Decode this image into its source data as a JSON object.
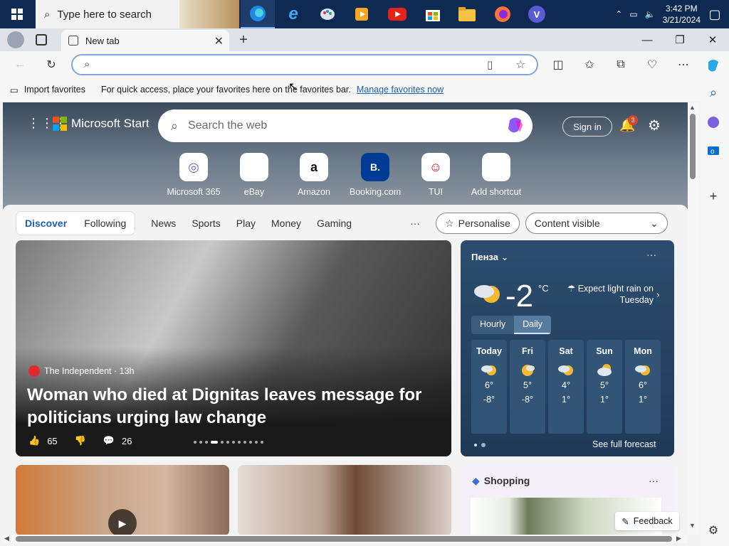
{
  "taskbar": {
    "search_placeholder": "Type here to search",
    "clock_time": "3:42 PM",
    "clock_date": "3/21/2024",
    "apps": [
      "edge",
      "ie",
      "paint",
      "media",
      "youtube",
      "store",
      "explorer",
      "firefox",
      "vpn"
    ],
    "vpn_letter": "V"
  },
  "browser": {
    "tab_title": "New tab",
    "address_value": "",
    "favorites": {
      "import_label": "Import favorites",
      "hint": "For quick access, place your favorites here on the favorites bar.",
      "manage_link": "Manage favorites now"
    }
  },
  "msn": {
    "brand": "Microsoft Start",
    "search_placeholder": "Search the web",
    "sign_in": "Sign in",
    "notification_count": "3",
    "shortcuts": [
      {
        "label": "Microsoft 365",
        "glyph": "◎"
      },
      {
        "label": "eBay",
        "glyph": "🛍"
      },
      {
        "label": "Amazon",
        "glyph": "a"
      },
      {
        "label": "Booking.com",
        "glyph": "B."
      },
      {
        "label": "TUI",
        "glyph": "☺"
      },
      {
        "label": "Add shortcut",
        "glyph": "+"
      }
    ],
    "feed_tabs": [
      "Discover",
      "Following",
      "News",
      "Sports",
      "Play",
      "Money",
      "Gaming"
    ],
    "more": "···",
    "personalise": "Personalise",
    "content_visible": "Content visible"
  },
  "news": {
    "source": "The Independent · 13h",
    "title": "Woman who died at Dignitas leaves message for politicians urging law change",
    "likes": "65",
    "comments": "26"
  },
  "weather": {
    "city": "Пенза",
    "temp": "-2",
    "unit": "°C",
    "expect": "Expect light rain on Tuesday",
    "modes": [
      "Hourly",
      "Daily"
    ],
    "days": [
      {
        "day": "Today",
        "hi": "6°",
        "lo": "-8°"
      },
      {
        "day": "Fri",
        "hi": "5°",
        "lo": "-8°"
      },
      {
        "day": "Sat",
        "hi": "4°",
        "lo": "1°"
      },
      {
        "day": "Sun",
        "hi": "5°",
        "lo": "1°"
      },
      {
        "day": "Mon",
        "hi": "6°",
        "lo": "1°"
      }
    ],
    "full_forecast": "See full forecast"
  },
  "shopping": {
    "title": "Shopping"
  },
  "feedback": "Feedback"
}
